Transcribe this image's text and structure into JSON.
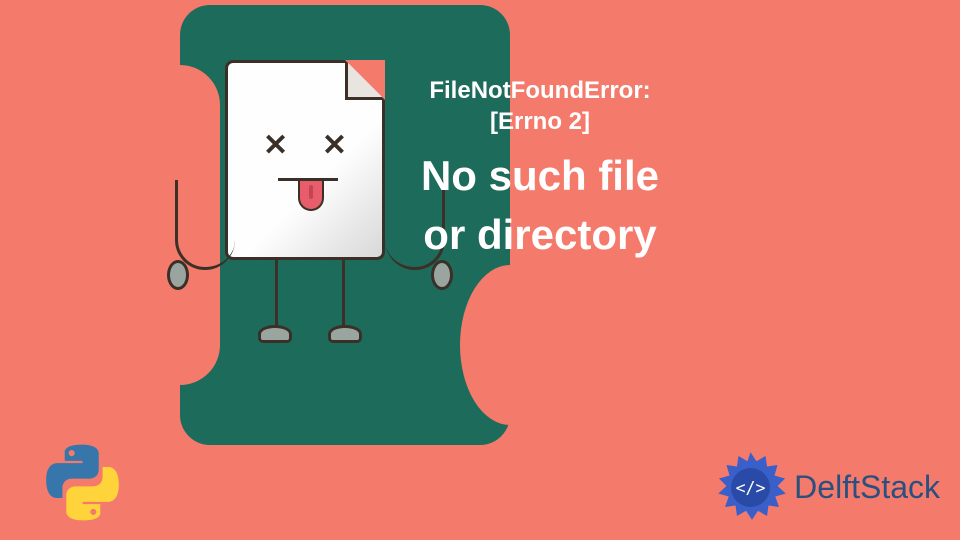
{
  "error": {
    "line1": "FileNotFoundError:",
    "line2": "[Errno 2]",
    "main": "No such file or directory"
  },
  "brand": {
    "name": "DelftStack"
  }
}
